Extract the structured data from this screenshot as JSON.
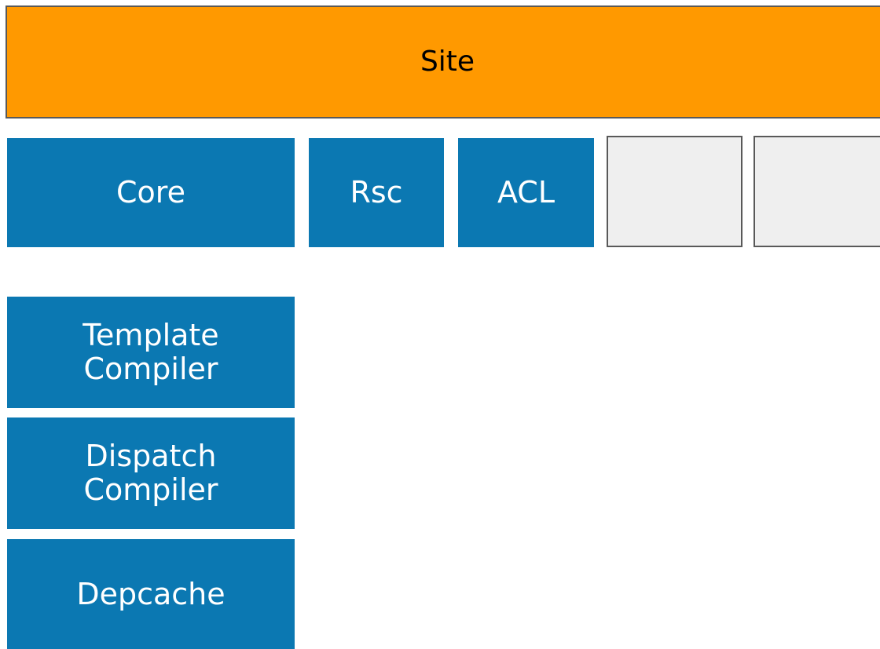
{
  "diagram": {
    "site": {
      "label": "Site"
    },
    "top_modules": [
      {
        "label": "Core"
      },
      {
        "label": "Rsc"
      },
      {
        "label": "ACL"
      }
    ],
    "empty_slots": [
      {
        "label": ""
      },
      {
        "label": ""
      }
    ],
    "lower_modules": [
      {
        "label": "Template\nCompiler"
      },
      {
        "label": "Dispatch\nCompiler"
      },
      {
        "label": "Depcache"
      }
    ]
  },
  "colors": {
    "site": "#ff9900",
    "module": "#0b78b2",
    "empty_slot": "#efefef",
    "border": "#595959",
    "module_text": "#ffffff",
    "site_text": "#000000"
  }
}
